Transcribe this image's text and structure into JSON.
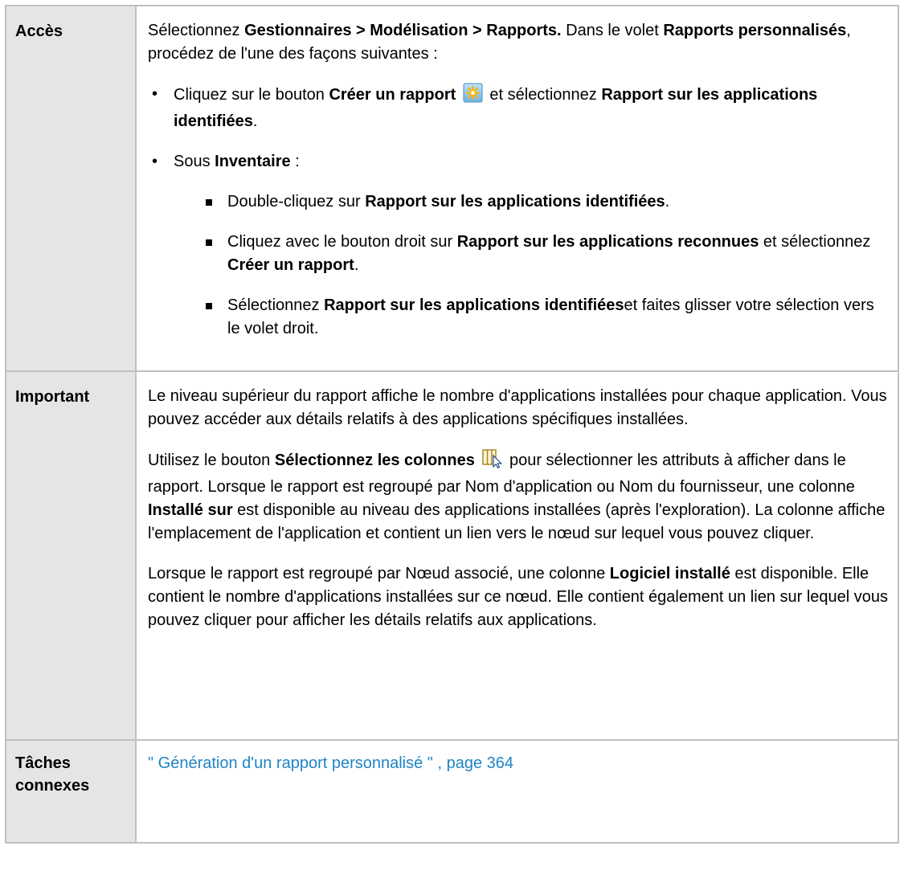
{
  "rows": {
    "acces": {
      "label": "Accès",
      "intro": {
        "t1": "Sélectionnez ",
        "b1": "Gestionnaires > Modélisation > Rapports.",
        "t2": " Dans le volet ",
        "b2": "Rapports personnalisés",
        "t3": ", procédez de l'une des façons suivantes :"
      },
      "bullet1": {
        "t1": "Cliquez sur le bouton ",
        "b1": "Créer un rapport",
        "icon": "create-report-icon",
        "t2": " et sélectionnez ",
        "b2": "Rapport sur les applications identifiées",
        "t3": "."
      },
      "bullet2": {
        "t1": "Sous ",
        "b1": "Inventaire",
        "t2": " :"
      },
      "sub1": {
        "t1": "Double-cliquez sur ",
        "b1": "Rapport sur les applications identifiées",
        "t2": "."
      },
      "sub2": {
        "t1": "Cliquez avec le bouton droit sur ",
        "b1": "Rapport sur les applications reconnues",
        "t2": " et sélectionnez ",
        "b2": "Créer un rapport",
        "t3": "."
      },
      "sub3": {
        "t1": "Sélectionnez ",
        "b1": "Rapport sur les applications identifiées",
        "t2": "et faites glisser votre sélection vers le volet droit."
      }
    },
    "important": {
      "label": "Important",
      "p1": "Le niveau supérieur du rapport affiche le nombre d'applications installées pour chaque application. Vous pouvez accéder aux détails relatifs à des applications spécifiques installées.",
      "p2": {
        "t1": "Utilisez le bouton ",
        "b1": "Sélectionnez les colonnes",
        "icon": "select-columns-icon",
        "t2": " pour sélectionner les attributs à afficher dans le rapport. Lorsque le rapport est regroupé par Nom d'application ou Nom du fournisseur, une colonne ",
        "b2": "Installé sur",
        "t3": " est disponible au niveau des applications installées (après l'exploration). La colonne affiche l'emplacement de l'application et contient un lien vers le nœud sur lequel vous pouvez cliquer."
      },
      "p3": {
        "t1": "Lorsque le rapport est regroupé par Nœud associé, une colonne ",
        "b1": "Logiciel installé",
        "t2": " est disponible. Elle contient le nombre d'applications installées sur ce nœud. Elle contient également un lien sur lequel vous pouvez cliquer pour afficher les détails relatifs aux applications."
      }
    },
    "taches": {
      "label_line1": "Tâches",
      "label_line2": "connexes",
      "link": "\" Génération d'un rapport personnalisé \" , page 364",
      "link_color": "#1f84c6"
    }
  }
}
